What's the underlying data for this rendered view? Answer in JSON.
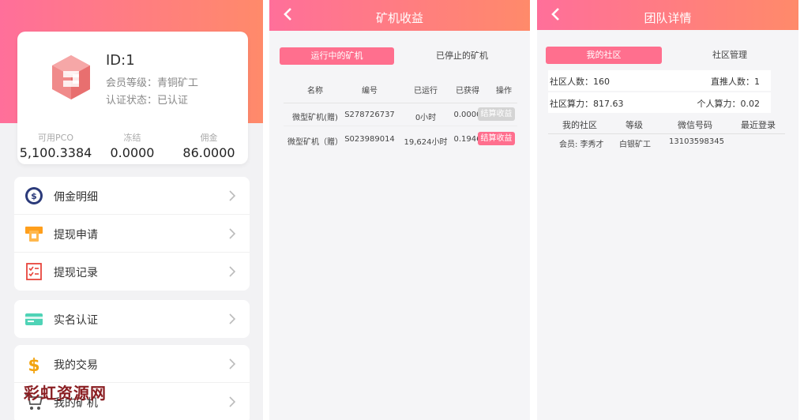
{
  "panel_account": {
    "profile": {
      "id_text": "ID:1",
      "level_text": "会员等级：青铜矿工",
      "status_text": "认证状态：已认证"
    },
    "stats": [
      {
        "label": "可用PCO",
        "value": "5,100.3384"
      },
      {
        "label": "冻结",
        "value": "0.0000"
      },
      {
        "label": "佣金",
        "value": "86.0000"
      }
    ],
    "menu_group_1": [
      {
        "label": "佣金明细",
        "icon": "dollar-circle-icon"
      },
      {
        "label": "提现申请",
        "icon": "withdraw-card-icon"
      },
      {
        "label": "提现记录",
        "icon": "receipt-checklist-icon"
      }
    ],
    "menu_group_2": [
      {
        "label": "实名认证",
        "icon": "id-card-icon"
      }
    ],
    "menu_group_3": [
      {
        "label": "我的交易",
        "icon": "dollar-sign-icon"
      },
      {
        "label": "我的矿机",
        "icon": "cart-icon"
      }
    ],
    "watermark": "彩虹资源网"
  },
  "panel_miner": {
    "title": "矿机收益",
    "tabs": [
      "运行中的矿机",
      "已停止的矿机"
    ],
    "columns": [
      "名称",
      "编号",
      "已运行",
      "已获得",
      "操作"
    ],
    "rows": [
      {
        "name": "微型矿机(赠)",
        "code": "S278726737",
        "run": "0小时",
        "got": "0.0000",
        "action": "结算收益",
        "enabled": false
      },
      {
        "name": "微型矿机（赠）",
        "code": "S023989014",
        "run": "19,624小时",
        "got": "0.1946",
        "action": "结算收益",
        "enabled": true
      }
    ]
  },
  "panel_team": {
    "title": "团队详情",
    "tabs": [
      "我的社区",
      "社区管理"
    ],
    "summary": {
      "community_count": "社区人数：160",
      "direct_count": "直推人数：1",
      "community_power": "社区算力：817.63",
      "personal_power": "个人算力：0.02"
    },
    "columns": [
      "我的社区",
      "等级",
      "微信号码",
      "最近登录"
    ],
    "rows": [
      {
        "member": "会员: 李秀才",
        "level": "白银矿工",
        "wechat": "13103598345",
        "last_login": ""
      }
    ]
  },
  "colors": {
    "gradient_start": "#ff6f9a",
    "gradient_end": "#ff8a6a",
    "accent_pink": "#ff6f8e",
    "disabled_gray": "#d4d4d4"
  }
}
